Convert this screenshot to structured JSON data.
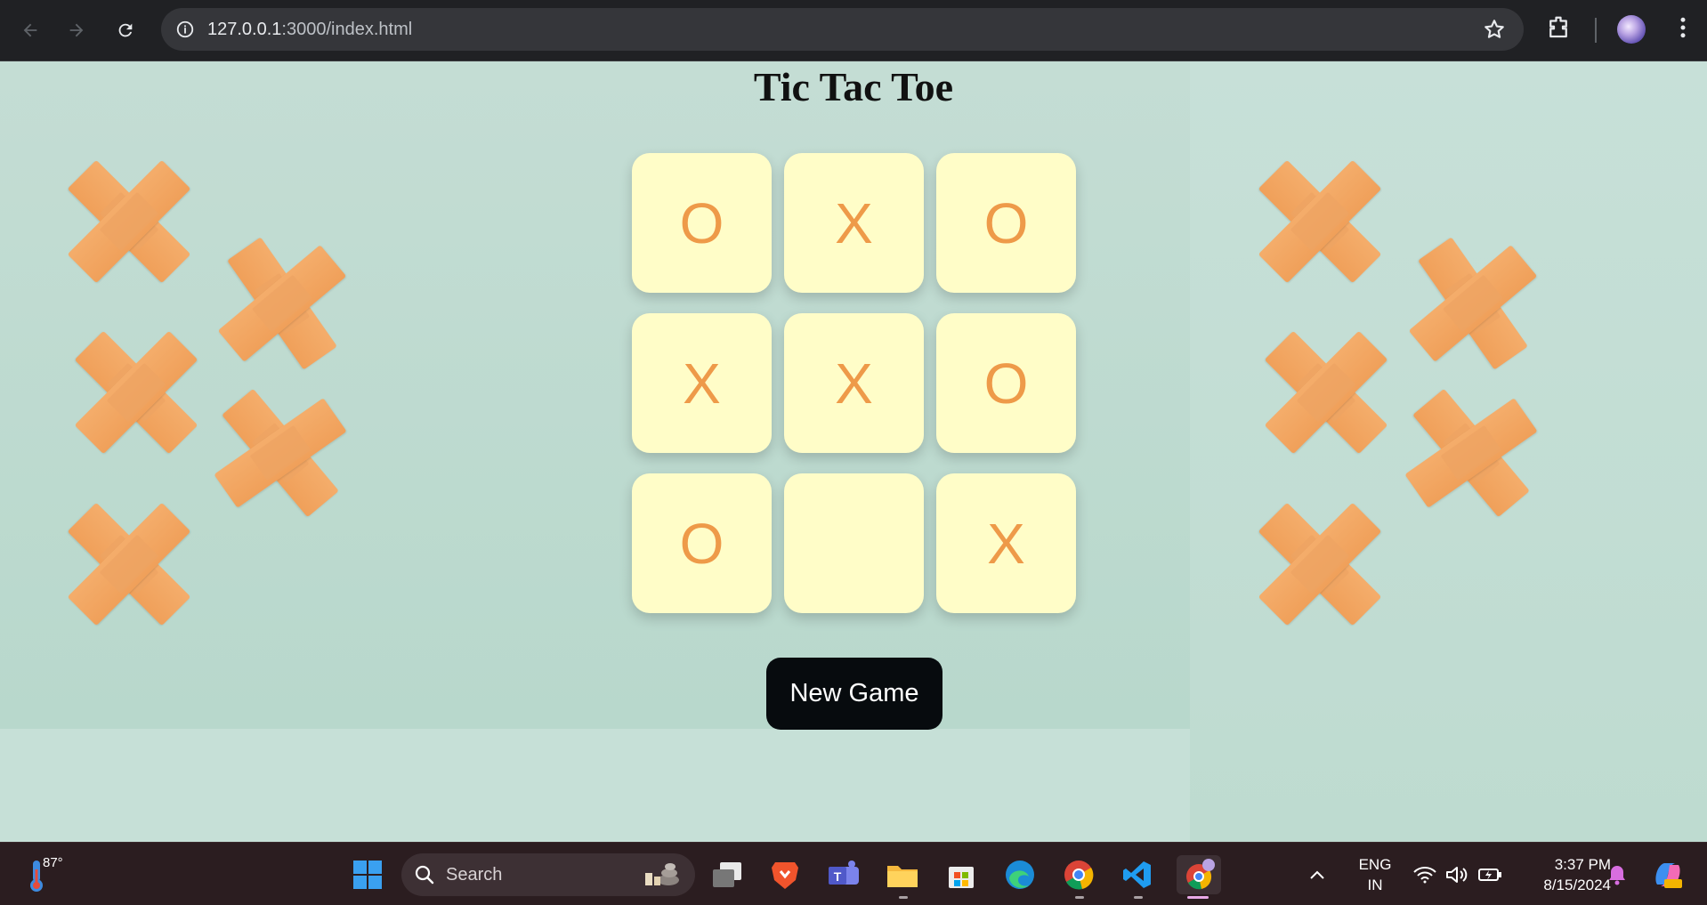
{
  "browser": {
    "url_host": "127.0.0.1",
    "url_rest": ":3000/index.html"
  },
  "page": {
    "title": "Tic Tac Toe",
    "board": [
      [
        "O",
        "X",
        "O"
      ],
      [
        "X",
        "X",
        "O"
      ],
      [
        "O",
        "",
        "X"
      ]
    ],
    "new_game_label": "New Game"
  },
  "colors": {
    "cell_bg": "#fffdc8",
    "mark_color": "#ee9a49",
    "button_bg": "#070b0e",
    "page_bg": "#c9e0d8"
  },
  "taskbar": {
    "weather_temp": "87°",
    "search_label": "Search",
    "language_line1": "ENG",
    "language_line2": "IN",
    "time": "3:37 PM",
    "date": "8/15/2024",
    "apps": [
      "windows-start-icon",
      "task-view-icon",
      "brave-browser-icon",
      "teams-icon",
      "file-explorer-icon",
      "microsoft-store-icon",
      "edge-browser-icon",
      "chrome-browser-icon",
      "vscode-icon",
      "chrome-active-icon"
    ]
  }
}
